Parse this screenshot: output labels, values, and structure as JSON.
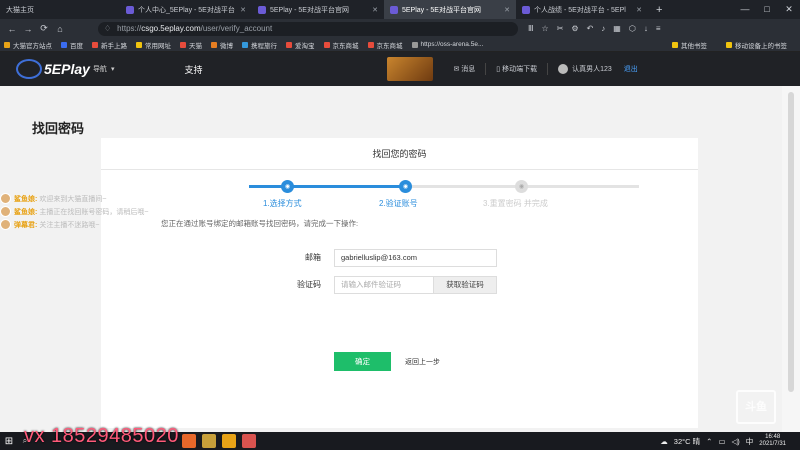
{
  "browser": {
    "tabs": [
      {
        "label": "大猫主页",
        "active": false
      },
      {
        "label": "个人中心_5EPlay - 5E对战平台",
        "active": false
      },
      {
        "label": "5EPlay - 5E对战平台官网",
        "active": false
      },
      {
        "label": "5EPlay - 5E对战平台官网",
        "active": true
      },
      {
        "label": "个人战绩 - 5E对战平台 - 5EPl",
        "active": false
      }
    ],
    "url_scheme": "https://",
    "url_host": "csgo.5eplay.com",
    "url_path": "/user/verify_account",
    "bookmarks": [
      "大猫官方站点",
      "百度",
      "新手上路",
      "常用网址",
      "天猫",
      "微博",
      "携程旅行",
      "爱淘宝",
      "京东商城",
      "京东商城",
      "https://oss-arena.5e..."
    ],
    "bookmarks_right": [
      "其他书签",
      "移动设备上的书签"
    ]
  },
  "site": {
    "logo_text": "5EPlay",
    "logo_sub": "导航",
    "support_label": "支持",
    "messages_label": "消息",
    "mobile_download_label": "移动端下载",
    "user_label": "认真男人123",
    "logout_label": "退出"
  },
  "page": {
    "title": "找回密码",
    "card_title": "找回您的密码",
    "steps": [
      {
        "label": "1.选择方式",
        "done": true
      },
      {
        "label": "2.验证账号",
        "done": true
      },
      {
        "label": "3.重置密码 并完成",
        "done": false
      }
    ],
    "hint": "您正在通过账号绑定的邮箱账号找回密码，请完成一下操作:",
    "email_label": "邮箱",
    "email_value": "gabrielluslip@163.com",
    "code_label": "验证码",
    "code_placeholder": "请输入邮件验证码",
    "get_code_label": "获取验证码",
    "confirm_label": "确定",
    "back_label": "返回上一步"
  },
  "chat": [
    {
      "name": "鲨鱼娘:",
      "message": "欢迎来到大猫直播间~"
    },
    {
      "name": "鲨鱼娘:",
      "message": "主播正在找回账号密码，请稍后哦~"
    },
    {
      "name": "弹幕君:",
      "message": "关注主播不迷路哦~"
    }
  ],
  "overlay": {
    "promo": "vx 18529485020",
    "watermark": "斗鱼"
  },
  "taskbar": {
    "weather": "32°C 晴",
    "lang": "中",
    "time": "16:48",
    "date": "2021/7/31"
  },
  "colors": {
    "accent": "#2a8ddc",
    "confirm": "#1ebe6a",
    "header_bg": "#202226"
  }
}
